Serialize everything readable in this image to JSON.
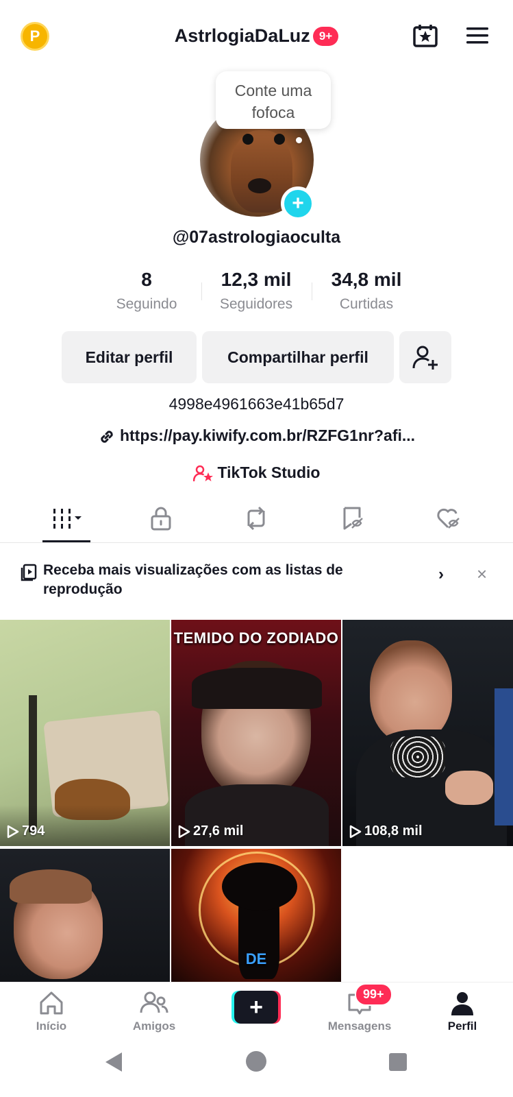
{
  "header": {
    "coin_label": "P",
    "title": "AstrlogiaDaLuz",
    "notification_badge": "9+"
  },
  "profile": {
    "bubble_text": "Conte uma fofoca",
    "username": "@07astrologiaoculta",
    "stats": [
      {
        "value": "8",
        "label": "Seguindo"
      },
      {
        "value": "12,3 mil",
        "label": "Seguidores"
      },
      {
        "value": "34,8 mil",
        "label": "Curtidas"
      }
    ],
    "buttons": {
      "edit": "Editar perfil",
      "share": "Compartilhar perfil"
    },
    "bio": "4998e4961663e41b65d7",
    "link": "https://pay.kiwify.com.br/RZFG1nr?afi...",
    "studio": "TikTok Studio"
  },
  "tabs": [
    "videos-grid-icon",
    "lock-icon",
    "repost-icon",
    "saved-icon",
    "liked-icon"
  ],
  "banner": {
    "text": "Receba mais visualizações com as listas de reprodução"
  },
  "videos": [
    {
      "views": "794"
    },
    {
      "views": "27,6 mil",
      "caption": "TEMIDO DO ZODIADO"
    },
    {
      "views": "108,8 mil"
    },
    {
      "views": ""
    },
    {
      "views": "",
      "caption": "DE"
    }
  ],
  "bottom_nav": {
    "home": "Início",
    "friends": "Amigos",
    "messages": "Mensagens",
    "messages_badge": "99+",
    "profile": "Perfil"
  },
  "colors": {
    "accent_pink": "#fe2c55",
    "accent_cyan": "#25f4ee",
    "text_primary": "#161823",
    "text_secondary": "#8a8b91"
  }
}
